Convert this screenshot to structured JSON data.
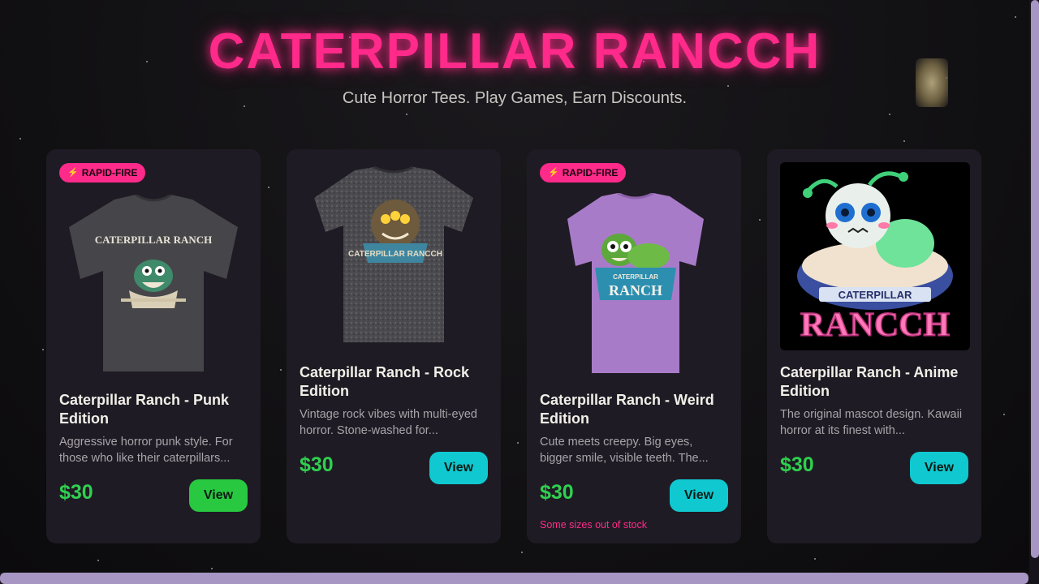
{
  "header": {
    "title": "CATERPILLAR RANCCH",
    "subtitle": "Cute Horror Tees. Play Games, Earn Discounts."
  },
  "colors": {
    "accent_pink": "#ff2a8a",
    "price_green": "#2fd04f",
    "view_green": "#28c840",
    "view_cyan": "#10c9d0",
    "card_bg": "#1f1b24",
    "scrollbar": "#a795c4"
  },
  "products": [
    {
      "badge": "RAPID-FIRE",
      "badge_icon": "lightning-icon",
      "title": "Caterpillar Ranch - Punk Edition",
      "description": "Aggressive horror punk style. For those who like their caterpillars...",
      "price": "$30",
      "button": "View",
      "image_text": "CATERPILLAR RANCH"
    },
    {
      "title": "Caterpillar Ranch - Rock Edition",
      "description": "Vintage rock vibes with multi-eyed horror. Stone-washed for...",
      "price": "$30",
      "button": "View",
      "image_text": "CATERPILLAR RANCCH"
    },
    {
      "badge": "RAPID-FIRE",
      "badge_icon": "lightning-icon",
      "title": "Caterpillar Ranch - Weird Edition",
      "description": "Cute meets creepy. Big eyes, bigger smile, visible teeth. The...",
      "price": "$30",
      "button": "View",
      "stock_note": "Some sizes out of stock",
      "image_text_top": "CATERPILLAR",
      "image_text_bottom": "RANCH"
    },
    {
      "title": "Caterpillar Ranch - Anime Edition",
      "description": "The original mascot design. Kawaii horror at its finest with...",
      "price": "$30",
      "button": "View",
      "image_text_top": "CATERPILLAR",
      "image_text_bottom": "RANCCH"
    }
  ]
}
